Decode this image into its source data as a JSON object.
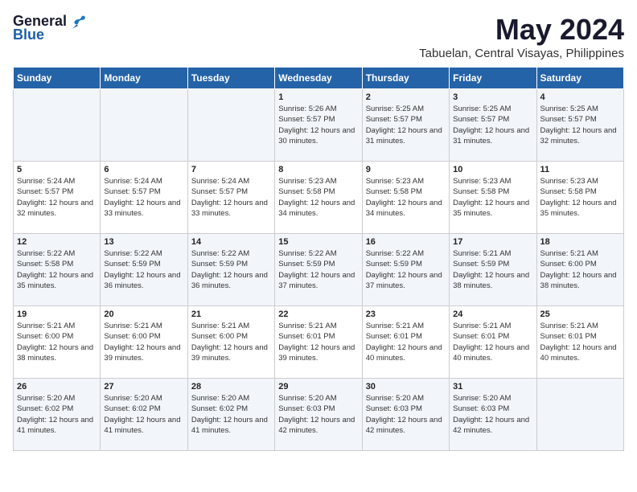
{
  "header": {
    "logo_general": "General",
    "logo_blue": "Blue",
    "month": "May 2024",
    "location": "Tabuelan, Central Visayas, Philippines"
  },
  "days_of_week": [
    "Sunday",
    "Monday",
    "Tuesday",
    "Wednesday",
    "Thursday",
    "Friday",
    "Saturday"
  ],
  "weeks": [
    [
      {
        "num": "",
        "info": ""
      },
      {
        "num": "",
        "info": ""
      },
      {
        "num": "",
        "info": ""
      },
      {
        "num": "1",
        "info": "Sunrise: 5:26 AM\nSunset: 5:57 PM\nDaylight: 12 hours and 30 minutes."
      },
      {
        "num": "2",
        "info": "Sunrise: 5:25 AM\nSunset: 5:57 PM\nDaylight: 12 hours and 31 minutes."
      },
      {
        "num": "3",
        "info": "Sunrise: 5:25 AM\nSunset: 5:57 PM\nDaylight: 12 hours and 31 minutes."
      },
      {
        "num": "4",
        "info": "Sunrise: 5:25 AM\nSunset: 5:57 PM\nDaylight: 12 hours and 32 minutes."
      }
    ],
    [
      {
        "num": "5",
        "info": "Sunrise: 5:24 AM\nSunset: 5:57 PM\nDaylight: 12 hours and 32 minutes."
      },
      {
        "num": "6",
        "info": "Sunrise: 5:24 AM\nSunset: 5:57 PM\nDaylight: 12 hours and 33 minutes."
      },
      {
        "num": "7",
        "info": "Sunrise: 5:24 AM\nSunset: 5:57 PM\nDaylight: 12 hours and 33 minutes."
      },
      {
        "num": "8",
        "info": "Sunrise: 5:23 AM\nSunset: 5:58 PM\nDaylight: 12 hours and 34 minutes."
      },
      {
        "num": "9",
        "info": "Sunrise: 5:23 AM\nSunset: 5:58 PM\nDaylight: 12 hours and 34 minutes."
      },
      {
        "num": "10",
        "info": "Sunrise: 5:23 AM\nSunset: 5:58 PM\nDaylight: 12 hours and 35 minutes."
      },
      {
        "num": "11",
        "info": "Sunrise: 5:23 AM\nSunset: 5:58 PM\nDaylight: 12 hours and 35 minutes."
      }
    ],
    [
      {
        "num": "12",
        "info": "Sunrise: 5:22 AM\nSunset: 5:58 PM\nDaylight: 12 hours and 35 minutes."
      },
      {
        "num": "13",
        "info": "Sunrise: 5:22 AM\nSunset: 5:59 PM\nDaylight: 12 hours and 36 minutes."
      },
      {
        "num": "14",
        "info": "Sunrise: 5:22 AM\nSunset: 5:59 PM\nDaylight: 12 hours and 36 minutes."
      },
      {
        "num": "15",
        "info": "Sunrise: 5:22 AM\nSunset: 5:59 PM\nDaylight: 12 hours and 37 minutes."
      },
      {
        "num": "16",
        "info": "Sunrise: 5:22 AM\nSunset: 5:59 PM\nDaylight: 12 hours and 37 minutes."
      },
      {
        "num": "17",
        "info": "Sunrise: 5:21 AM\nSunset: 5:59 PM\nDaylight: 12 hours and 38 minutes."
      },
      {
        "num": "18",
        "info": "Sunrise: 5:21 AM\nSunset: 6:00 PM\nDaylight: 12 hours and 38 minutes."
      }
    ],
    [
      {
        "num": "19",
        "info": "Sunrise: 5:21 AM\nSunset: 6:00 PM\nDaylight: 12 hours and 38 minutes."
      },
      {
        "num": "20",
        "info": "Sunrise: 5:21 AM\nSunset: 6:00 PM\nDaylight: 12 hours and 39 minutes."
      },
      {
        "num": "21",
        "info": "Sunrise: 5:21 AM\nSunset: 6:00 PM\nDaylight: 12 hours and 39 minutes."
      },
      {
        "num": "22",
        "info": "Sunrise: 5:21 AM\nSunset: 6:01 PM\nDaylight: 12 hours and 39 minutes."
      },
      {
        "num": "23",
        "info": "Sunrise: 5:21 AM\nSunset: 6:01 PM\nDaylight: 12 hours and 40 minutes."
      },
      {
        "num": "24",
        "info": "Sunrise: 5:21 AM\nSunset: 6:01 PM\nDaylight: 12 hours and 40 minutes."
      },
      {
        "num": "25",
        "info": "Sunrise: 5:21 AM\nSunset: 6:01 PM\nDaylight: 12 hours and 40 minutes."
      }
    ],
    [
      {
        "num": "26",
        "info": "Sunrise: 5:20 AM\nSunset: 6:02 PM\nDaylight: 12 hours and 41 minutes."
      },
      {
        "num": "27",
        "info": "Sunrise: 5:20 AM\nSunset: 6:02 PM\nDaylight: 12 hours and 41 minutes."
      },
      {
        "num": "28",
        "info": "Sunrise: 5:20 AM\nSunset: 6:02 PM\nDaylight: 12 hours and 41 minutes."
      },
      {
        "num": "29",
        "info": "Sunrise: 5:20 AM\nSunset: 6:03 PM\nDaylight: 12 hours and 42 minutes."
      },
      {
        "num": "30",
        "info": "Sunrise: 5:20 AM\nSunset: 6:03 PM\nDaylight: 12 hours and 42 minutes."
      },
      {
        "num": "31",
        "info": "Sunrise: 5:20 AM\nSunset: 6:03 PM\nDaylight: 12 hours and 42 minutes."
      },
      {
        "num": "",
        "info": ""
      }
    ]
  ]
}
